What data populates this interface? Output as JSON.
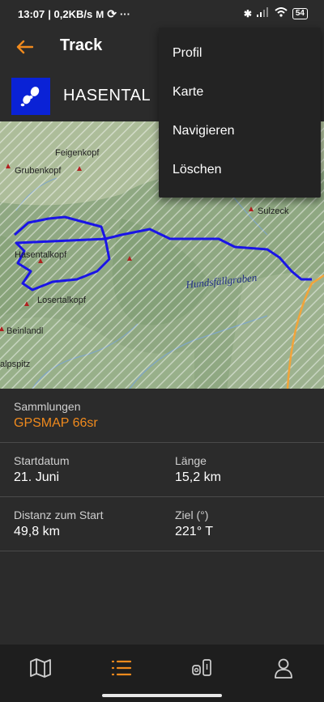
{
  "status": {
    "time": "13:07",
    "speed": "| 0,2KB/s",
    "battery": "54"
  },
  "appbar": {
    "title": "Track"
  },
  "track": {
    "name": "HASENTAL"
  },
  "map": {
    "labels": {
      "feigenkopf": "Feigenkopf",
      "grubenkopf": "Grubenkopf",
      "sulzeck": "Sulzeck",
      "hasentalkopf": "Hasentalkopf",
      "hundsfallgraben": "Hundsfällgraben",
      "losertalkopf": "Losertalkopf",
      "beinlandl": "Beinlandl",
      "alpspitz": "alpspitz"
    },
    "colors": {
      "route": "#1a14e6",
      "forest": "#86a47a",
      "meadow": "#c9d2b6"
    }
  },
  "info": {
    "collections_label": "Sammlungen",
    "collections_value": "GPSMAP 66sr",
    "start_date_label": "Startdatum",
    "start_date_value": "21. Juni",
    "length_label": "Länge",
    "length_value": "15,2 km",
    "distance_label": "Distanz zum Start",
    "distance_value": "49,8 km",
    "target_label": "Ziel (°)",
    "target_value": "221° T"
  },
  "menu": {
    "items": [
      "Profil",
      "Karte",
      "Navigieren",
      "Löschen"
    ]
  },
  "nav": {
    "icons": [
      "map-icon",
      "list-icon",
      "device-icon",
      "profile-icon"
    ],
    "accent": "#f08a1d"
  }
}
